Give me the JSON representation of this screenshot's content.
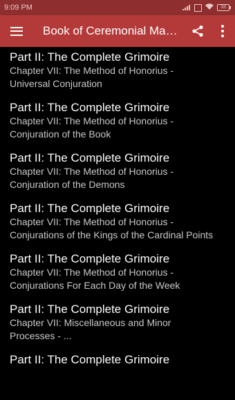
{
  "status_bar": {
    "time": "9:09 PM",
    "battery": "33"
  },
  "app_bar": {
    "title": "Book of Ceremonial Magic"
  },
  "items": [
    {
      "title": "Part II: The Complete Grimoire",
      "line1": "Chapter VII: The Method of Honorius -",
      "line2": "Universal Conjuration"
    },
    {
      "title": "Part II: The Complete Grimoire",
      "line1": "Chapter VII: The Method of Honorius -",
      "line2": "Conjuration of the Book"
    },
    {
      "title": "Part II: The Complete Grimoire",
      "line1": "Chapter VII: The Method of Honorius -",
      "line2": "Conjuration of the Demons"
    },
    {
      "title": "Part II: The Complete Grimoire",
      "line1": "Chapter VII: The Method of Honorius -",
      "line2": "Conjurations of the Kings of the Cardinal Points"
    },
    {
      "title": "Part II: The Complete Grimoire",
      "line1": "Chapter VII: The Method of Honorius -",
      "line2": "Conjurations For Each Day of the Week"
    },
    {
      "title": "Part II: The Complete Grimoire",
      "line1": "Chapter VII: Miscellaneous and Minor",
      "line2": "Processes - ..."
    },
    {
      "title": "Part II: The Complete Grimoire",
      "line1": "",
      "line2": ""
    }
  ]
}
